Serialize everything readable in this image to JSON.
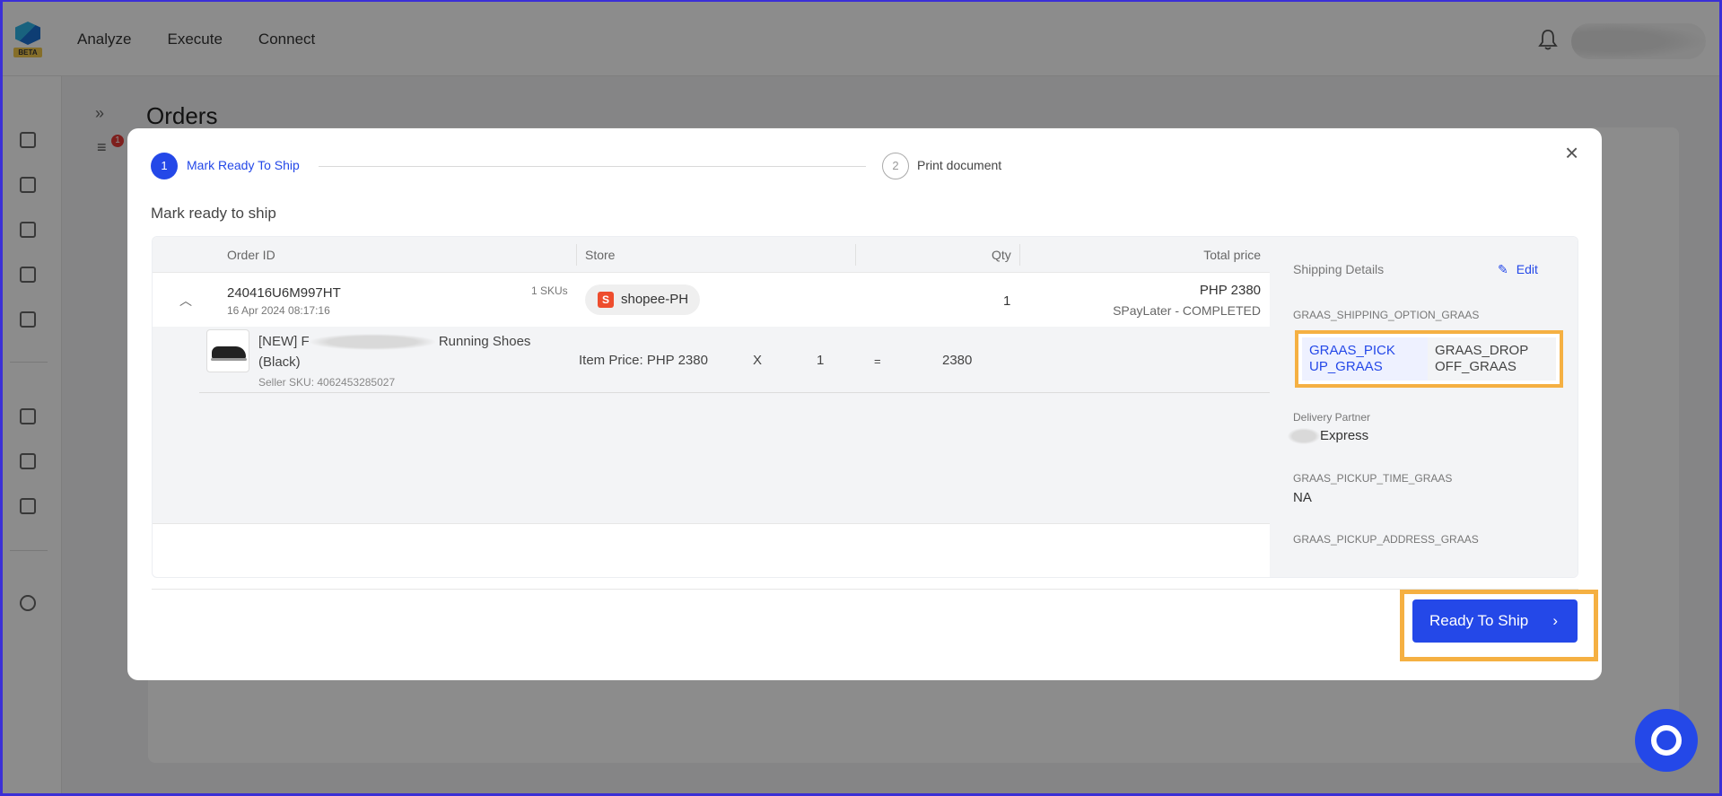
{
  "app": {
    "badge": "BETA",
    "nav": [
      "Analyze",
      "Execute",
      "Connect"
    ],
    "page_title": "Orders",
    "filter_badge": "1"
  },
  "modal": {
    "steps": [
      {
        "number": "1",
        "label": "Mark Ready To Ship",
        "state": "active"
      },
      {
        "number": "2",
        "label": "Print document",
        "state": "pending"
      }
    ],
    "section_title": "Mark ready to ship",
    "table": {
      "headers": {
        "order_id": "Order ID",
        "store": "Store",
        "qty": "Qty",
        "total_price": "Total price"
      },
      "order": {
        "id": "240416U6M997HT",
        "date": "16 Apr 2024 08:17:16",
        "skus": "1 SKUs",
        "store": "shopee-PH",
        "qty": "1",
        "price": "PHP 2380",
        "payment_status": "SPayLater - COMPLETED"
      },
      "item": {
        "name_prefix": "[NEW] F",
        "name_suffix": "Running Shoes",
        "name_line2": "(Black)",
        "seller_sku": "Seller SKU: 4062453285027",
        "item_price": "Item Price: PHP 2380",
        "times": "X",
        "qty": "1",
        "equals": "=",
        "total": "2380"
      }
    },
    "shipping": {
      "title": "Shipping Details",
      "edit_label": "Edit",
      "option_label": "GRAAS_SHIPPING_OPTION_GRAAS",
      "options": [
        "GRAAS_PICK UP_GRAAS",
        "GRAAS_DROP OFF_GRAAS"
      ],
      "selected_option": "GRAAS_PICK UP_GRAAS",
      "partner_label": "Delivery Partner",
      "partner_value": "Express",
      "pickup_time_label": "GRAAS_PICKUP_TIME_GRAAS",
      "pickup_time_value": "NA",
      "pickup_address_label": "GRAAS_PICKUP_ADDRESS_GRAAS"
    },
    "primary_button": "Ready To Ship",
    "close_icon": "close-icon"
  },
  "colors": {
    "accent": "#2448e8",
    "highlight": "#f5b042",
    "shopee": "#ee4d2d",
    "overlay": "rgba(0,0,0,0.45)"
  }
}
